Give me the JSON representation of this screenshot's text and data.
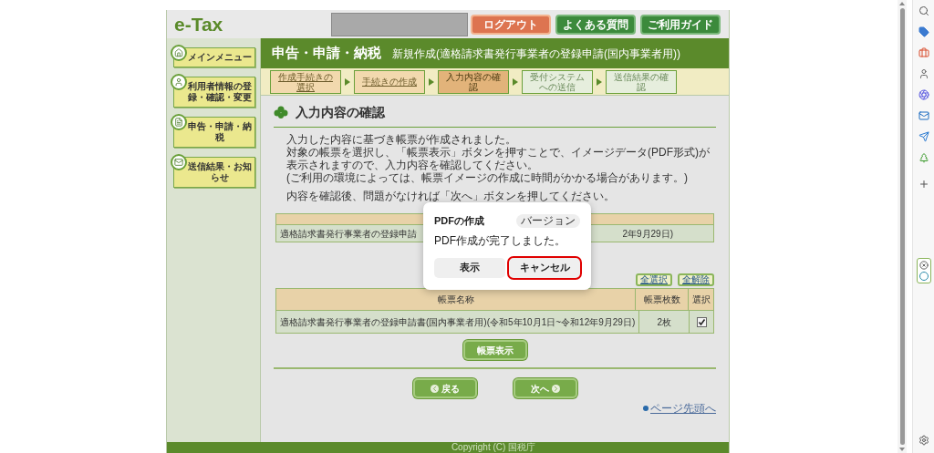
{
  "header": {
    "logo": "e-Tax",
    "buttons": [
      {
        "label": "ログアウト",
        "kind": "logout"
      },
      {
        "label": "よくある質問",
        "kind": "normal"
      },
      {
        "label": "ご利用ガイド",
        "kind": "normal"
      }
    ]
  },
  "nav": [
    {
      "label": "メインメニュー",
      "kind": "home"
    },
    {
      "label": "利用者情報の登録・確認・変更",
      "kind": "user"
    },
    {
      "label": "申告・申請・納税",
      "kind": "doc"
    },
    {
      "label": "送信結果・お知らせ",
      "kind": "mail"
    }
  ],
  "title_bar": {
    "section": "申告・申請・納税",
    "subtitle": "新規作成(適格請求書発行事業者の登録申請(国内事業者用))"
  },
  "steps": [
    {
      "label": "作成手続きの選択",
      "kind": "done"
    },
    {
      "label": "手続きの作成",
      "kind": "done"
    },
    {
      "label": "入力内容の確認",
      "kind": "current"
    },
    {
      "label": "受付システムへの送信",
      "kind": "pending"
    },
    {
      "label": "送信結果の確認",
      "kind": "pending"
    }
  ],
  "heading": "入力内容の確認",
  "intro": [
    "入力した内容に基づき帳票が作成されました。",
    "対象の帳票を選択し、「帳票表示」ボタンを押すことで、イメージデータ(PDF形式)が表示されますので、入力内容を確認してください。",
    "(ご利用の環境によっては、帳票イメージの作成に時間がかかる場合があります。)"
  ],
  "instruction": "内容を確認後、問題がなければ「次へ」ボタンを押してください。",
  "summary_table": {
    "row_fragments": [
      "適格請求書発行事業者の登録申請",
      "2年9月29日)"
    ]
  },
  "select_buttons": [
    "全選択",
    "全解除"
  ],
  "forms_table": {
    "columns": [
      "帳票名称",
      "帳票枚数",
      "選択"
    ],
    "rows": [
      {
        "name": "適格請求書発行事業者の登録申請書(国内事業者用)(令和5年10月1日~令和12年9月29日)",
        "count": "2枚",
        "checked": true
      }
    ]
  },
  "view_button": "帳票表示",
  "nav_buttons": [
    {
      "label": "戻る",
      "kind": "back"
    },
    {
      "label": "次へ",
      "kind": "next"
    }
  ],
  "top_link": "ページ先頭へ",
  "footer": "Copyright (C) 国税庁",
  "dialog": {
    "title": "PDFの作成",
    "badge": "バージョン",
    "message": "PDF作成が完了しました。",
    "buttons": [
      {
        "label": "表示",
        "highlighted": false
      },
      {
        "label": "キャンセル",
        "highlighted": true
      }
    ]
  }
}
